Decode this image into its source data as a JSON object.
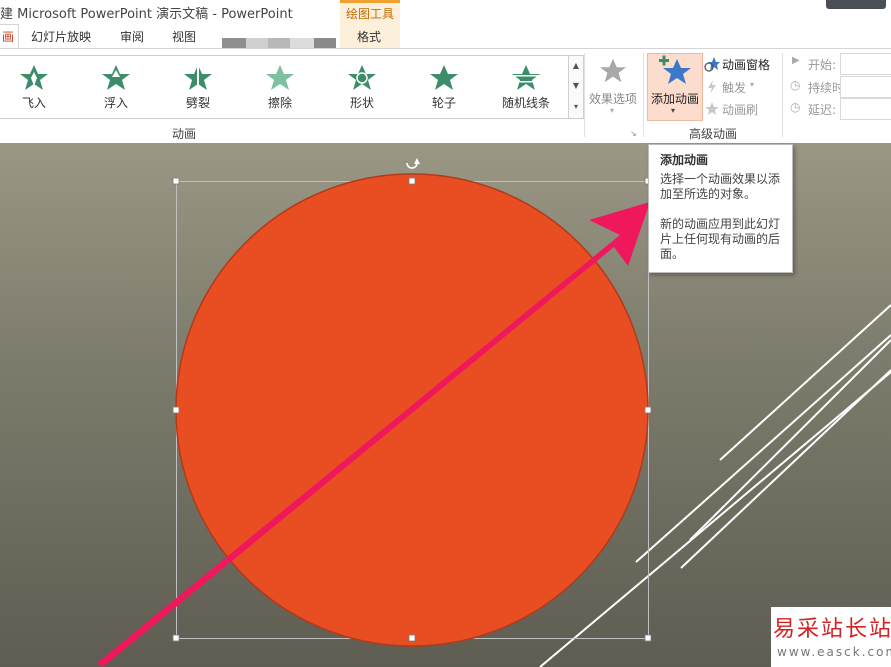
{
  "window": {
    "title": "建 Microsoft PowerPoint 演示文稿 - PowerPoint",
    "context_group": "绘图工具"
  },
  "tabs": {
    "active_fragment": "画",
    "items": [
      "幻灯片放映",
      "审阅",
      "视图"
    ],
    "format": "格式"
  },
  "animation_gallery": {
    "items": [
      {
        "label": "飞入",
        "icon": "fly-in-star-icon"
      },
      {
        "label": "浮入",
        "icon": "float-in-star-icon"
      },
      {
        "label": "劈裂",
        "icon": "split-star-icon"
      },
      {
        "label": "擦除",
        "icon": "wipe-star-icon"
      },
      {
        "label": "形状",
        "icon": "shape-star-icon"
      },
      {
        "label": "轮子",
        "icon": "wheel-star-icon"
      },
      {
        "label": "随机线条",
        "icon": "random-bars-star-icon"
      }
    ],
    "group_label": "动画"
  },
  "effect_options": {
    "label": "效果选项"
  },
  "advanced_animation": {
    "add_animation": "添加动画",
    "animation_pane": "动画窗格",
    "trigger": "触发",
    "animation_painter": "动画刷",
    "group_label": "高级动画"
  },
  "timing": {
    "start": "开始:",
    "duration": "持续时间:",
    "delay": "延迟:"
  },
  "tooltip": {
    "title": "添加动画",
    "line1": "选择一个动画效果以添加至所选的对象。",
    "line2": "新的动画应用到此幻灯片上任何现有动画的后面。"
  },
  "watermark": {
    "main": "易采站长站",
    "url": "www.easck.com"
  },
  "colors": {
    "accent": "#c43e1c",
    "circle_fill": "#e84e22",
    "arrow": "#f0185c",
    "star_green": "#3c8e6a"
  }
}
